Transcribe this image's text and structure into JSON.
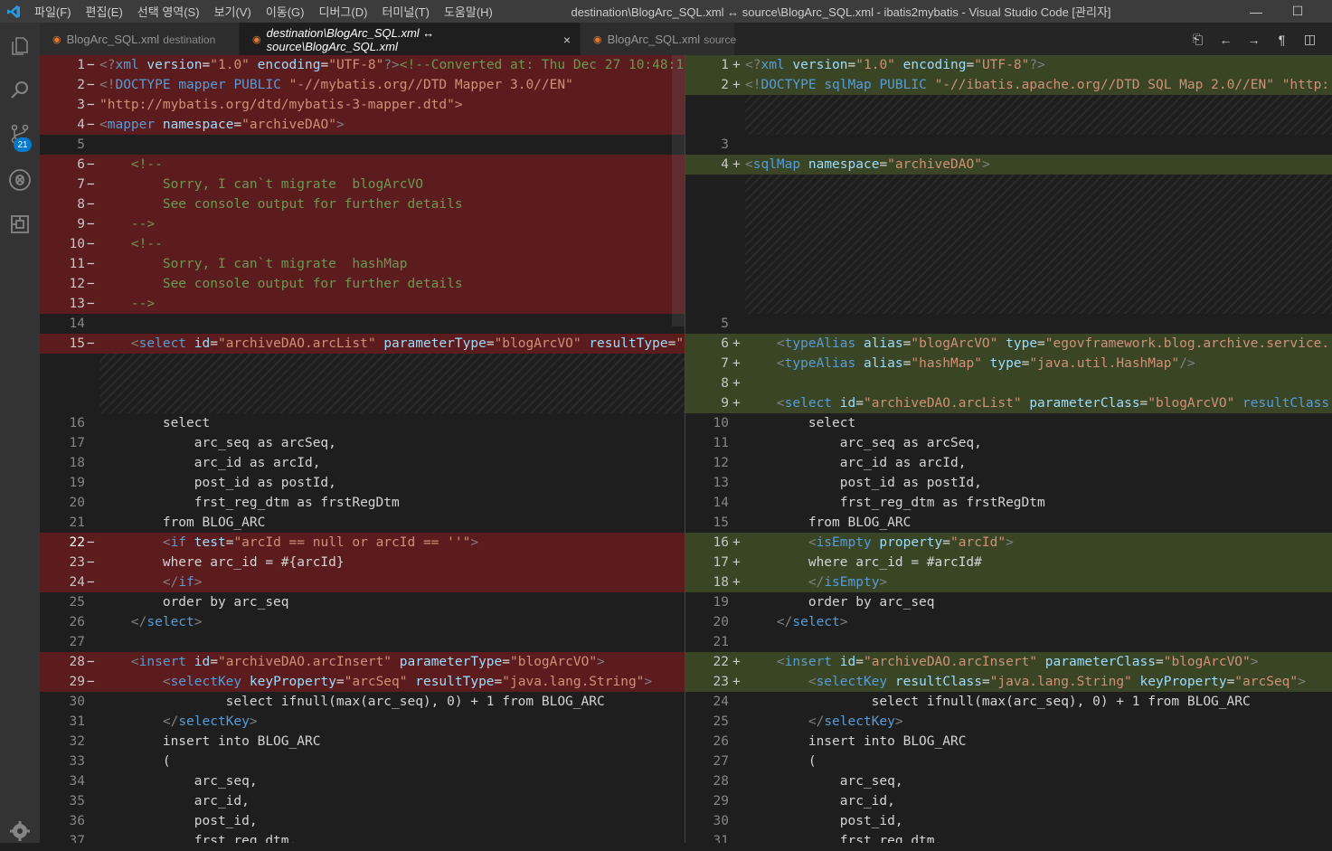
{
  "titlebar": {
    "menu": [
      "파일(F)",
      "편집(E)",
      "선택 영역(S)",
      "보기(V)",
      "이동(G)",
      "디버그(D)",
      "터미널(T)",
      "도움말(H)"
    ],
    "window_title": "destination\\BlogArc_SQL.xml ↔ source\\BlogArc_SQL.xml - ibatis2mybatis - Visual Studio Code [관리자]",
    "minimize": "—",
    "maximize": "☐"
  },
  "activity": {
    "badge": "21"
  },
  "tabs": [
    {
      "name": "BlogArc_SQL.xml",
      "desc": "destination"
    },
    {
      "name": "destination\\BlogArc_SQL.xml ↔ source\\BlogArc_SQL.xml",
      "desc": "",
      "close": "×"
    },
    {
      "name": "BlogArc_SQL.xml",
      "desc": "source"
    }
  ],
  "left_lines": [
    {
      "n": "1",
      "m": "−",
      "k": "del",
      "c": "<?xml version=\"1.0\" encoding=\"UTF-8\"?><!--Converted at: Thu Dec 27 10:48:1"
    },
    {
      "n": "2",
      "m": "−",
      "k": "del",
      "c": "<!DOCTYPE mapper PUBLIC \"-//mybatis.org//DTD Mapper 3.0//EN\""
    },
    {
      "n": "3",
      "m": "−",
      "k": "del",
      "c": "\"http://mybatis.org/dtd/mybatis-3-mapper.dtd\">"
    },
    {
      "n": "4",
      "m": "−",
      "k": "del",
      "c": "<mapper namespace=\"archiveDAO\">"
    },
    {
      "n": "5",
      "m": "",
      "k": "",
      "c": ""
    },
    {
      "n": "6",
      "m": "−",
      "k": "del",
      "c": "    <!--"
    },
    {
      "n": "7",
      "m": "−",
      "k": "del",
      "c": "        Sorry, I can`t migrate  blogArcVO"
    },
    {
      "n": "8",
      "m": "−",
      "k": "del",
      "c": "        See console output for further details"
    },
    {
      "n": "9",
      "m": "−",
      "k": "del",
      "c": "    -->"
    },
    {
      "n": "10",
      "m": "−",
      "k": "del",
      "c": "    <!--"
    },
    {
      "n": "11",
      "m": "−",
      "k": "del",
      "c": "        Sorry, I can`t migrate  hashMap"
    },
    {
      "n": "12",
      "m": "−",
      "k": "del",
      "c": "        See console output for further details"
    },
    {
      "n": "13",
      "m": "−",
      "k": "del",
      "c": "    -->"
    },
    {
      "n": "14",
      "m": "",
      "k": "",
      "c": ""
    },
    {
      "n": "15",
      "m": "−",
      "k": "del",
      "c": "    <select id=\"archiveDAO.arcList\" parameterType=\"blogArcVO\" resultType=\""
    },
    {
      "n": "16",
      "m": "",
      "k": "",
      "c": "        select"
    },
    {
      "n": "17",
      "m": "",
      "k": "",
      "c": "            arc_seq as arcSeq,"
    },
    {
      "n": "18",
      "m": "",
      "k": "",
      "c": "            arc_id as arcId,"
    },
    {
      "n": "19",
      "m": "",
      "k": "",
      "c": "            post_id as postId,"
    },
    {
      "n": "20",
      "m": "",
      "k": "",
      "c": "            frst_reg_dtm as frstRegDtm"
    },
    {
      "n": "21",
      "m": "",
      "k": "",
      "c": "        from BLOG_ARC"
    },
    {
      "n": "22",
      "m": "−",
      "k": "del",
      "c": "        <if test=\"arcId == null or arcId == ''\">"
    },
    {
      "n": "23",
      "m": "−",
      "k": "del",
      "c": "        where arc_id = #{arcId}"
    },
    {
      "n": "24",
      "m": "−",
      "k": "del",
      "c": "        </if>"
    },
    {
      "n": "25",
      "m": "",
      "k": "",
      "c": "        order by arc_seq"
    },
    {
      "n": "26",
      "m": "",
      "k": "",
      "c": "    </select>"
    },
    {
      "n": "27",
      "m": "",
      "k": "",
      "c": ""
    },
    {
      "n": "28",
      "m": "−",
      "k": "del",
      "c": "    <insert id=\"archiveDAO.arcInsert\" parameterType=\"blogArcVO\">"
    },
    {
      "n": "29",
      "m": "−",
      "k": "del",
      "c": "        <selectKey keyProperty=\"arcSeq\" resultType=\"java.lang.String\">"
    },
    {
      "n": "30",
      "m": "",
      "k": "",
      "c": "                select ifnull(max(arc_seq), 0) + 1 from BLOG_ARC"
    },
    {
      "n": "31",
      "m": "",
      "k": "",
      "c": "        </selectKey>"
    },
    {
      "n": "32",
      "m": "",
      "k": "",
      "c": "        insert into BLOG_ARC"
    },
    {
      "n": "33",
      "m": "",
      "k": "",
      "c": "        ("
    },
    {
      "n": "34",
      "m": "",
      "k": "",
      "c": "            arc_seq,"
    },
    {
      "n": "35",
      "m": "",
      "k": "",
      "c": "            arc_id,"
    },
    {
      "n": "36",
      "m": "",
      "k": "",
      "c": "            post_id,"
    },
    {
      "n": "37",
      "m": "",
      "k": "",
      "c": "            frst_reg_dtm,"
    }
  ],
  "right_lines": [
    {
      "n": "1",
      "m": "+",
      "k": "ins",
      "c": "<?xml version=\"1.0\" encoding=\"UTF-8\"?>"
    },
    {
      "n": "2",
      "m": "+",
      "k": "ins",
      "c": "<!DOCTYPE sqlMap PUBLIC \"-//ibatis.apache.org//DTD SQL Map 2.0//EN\" \"http:"
    },
    {
      "n": "3",
      "m": "",
      "k": "",
      "c": ""
    },
    {
      "n": "4",
      "m": "+",
      "k": "ins",
      "c": "<sqlMap namespace=\"archiveDAO\">"
    },
    {
      "n": "5",
      "m": "",
      "k": "",
      "c": ""
    },
    {
      "n": "6",
      "m": "+",
      "k": "ins",
      "c": "    <typeAlias alias=\"blogArcVO\" type=\"egovframework.blog.archive.service."
    },
    {
      "n": "7",
      "m": "+",
      "k": "ins",
      "c": "    <typeAlias alias=\"hashMap\" type=\"java.util.HashMap\"/>"
    },
    {
      "n": "8",
      "m": "+",
      "k": "ins",
      "c": ""
    },
    {
      "n": "9",
      "m": "+",
      "k": "ins",
      "c": "    <select id=\"archiveDAO.arcList\" parameterClass=\"blogArcVO\" resultClass"
    },
    {
      "n": "10",
      "m": "",
      "k": "",
      "c": "        select"
    },
    {
      "n": "11",
      "m": "",
      "k": "",
      "c": "            arc_seq as arcSeq,"
    },
    {
      "n": "12",
      "m": "",
      "k": "",
      "c": "            arc_id as arcId,"
    },
    {
      "n": "13",
      "m": "",
      "k": "",
      "c": "            post_id as postId,"
    },
    {
      "n": "14",
      "m": "",
      "k": "",
      "c": "            frst_reg_dtm as frstRegDtm"
    },
    {
      "n": "15",
      "m": "",
      "k": "",
      "c": "        from BLOG_ARC"
    },
    {
      "n": "16",
      "m": "+",
      "k": "ins",
      "c": "        <isEmpty property=\"arcId\">"
    },
    {
      "n": "17",
      "m": "+",
      "k": "ins",
      "c": "        where arc_id = #arcId#"
    },
    {
      "n": "18",
      "m": "+",
      "k": "ins",
      "c": "        </isEmpty>"
    },
    {
      "n": "19",
      "m": "",
      "k": "",
      "c": "        order by arc_seq"
    },
    {
      "n": "20",
      "m": "",
      "k": "",
      "c": "    </select>"
    },
    {
      "n": "21",
      "m": "",
      "k": "",
      "c": ""
    },
    {
      "n": "22",
      "m": "+",
      "k": "ins",
      "c": "    <insert id=\"archiveDAO.arcInsert\" parameterClass=\"blogArcVO\">"
    },
    {
      "n": "23",
      "m": "+",
      "k": "ins",
      "c": "        <selectKey resultClass=\"java.lang.String\" keyProperty=\"arcSeq\">"
    },
    {
      "n": "24",
      "m": "",
      "k": "",
      "c": "                select ifnull(max(arc_seq), 0) + 1 from BLOG_ARC"
    },
    {
      "n": "25",
      "m": "",
      "k": "",
      "c": "        </selectKey>"
    },
    {
      "n": "26",
      "m": "",
      "k": "",
      "c": "        insert into BLOG_ARC"
    },
    {
      "n": "27",
      "m": "",
      "k": "",
      "c": "        ("
    },
    {
      "n": "28",
      "m": "",
      "k": "",
      "c": "            arc_seq,"
    },
    {
      "n": "29",
      "m": "",
      "k": "",
      "c": "            arc_id,"
    },
    {
      "n": "30",
      "m": "",
      "k": "",
      "c": "            post_id,"
    },
    {
      "n": "31",
      "m": "",
      "k": "",
      "c": "            frst_reg_dtm,"
    }
  ],
  "current_line": "22"
}
